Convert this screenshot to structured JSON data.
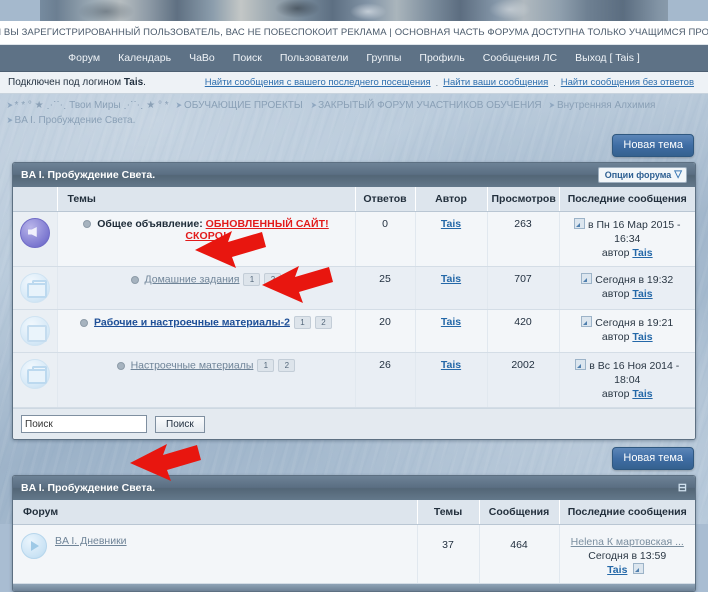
{
  "banner": {
    "notice": "ЕСЛИ ВЫ ЗАРЕГИСТРИРОВАННЫЙ ПОЛЬЗОВАТЕЛЬ, ВАС НЕ ПОБЕСПОКОИТ РЕКЛАМА | ОСНОВНАЯ ЧАСТЬ ФОРУМА ДОСТУПНА ТОЛЬКО УЧАЩИМСЯ ПРОЕКТА"
  },
  "nav": {
    "items": [
      {
        "label": "Форум",
        "name": "nav-forum"
      },
      {
        "label": "Календарь",
        "name": "nav-calendar"
      },
      {
        "label": "ЧаВо",
        "name": "nav-faq"
      },
      {
        "label": "Поиск",
        "name": "nav-search"
      },
      {
        "label": "Пользователи",
        "name": "nav-users"
      },
      {
        "label": "Группы",
        "name": "nav-groups"
      },
      {
        "label": "Профиль",
        "name": "nav-profile"
      },
      {
        "label": "Сообщения ЛС",
        "name": "nav-pm"
      },
      {
        "label": "Выход [ Tais ]",
        "name": "nav-logout"
      }
    ]
  },
  "login_strip": {
    "text_prefix": "Подключен под логином ",
    "username": "Tais",
    "text_suffix": ".",
    "quick_links": [
      "Найти сообщения с вашего последнего посещения",
      "Найти ваши сообщения",
      "Найти сообщения без ответов"
    ],
    "separator": "."
  },
  "breadcrumb": {
    "row1": [
      "* * ° ★ ⋰⋱ Твои Миры ⋰⋱ ★ ° *",
      "ОБУЧАЮЩИЕ ПРОЕКТЫ",
      "ЗАКРЫТЫЙ ФОРУМ УЧАСТНИКОВ ОБУЧЕНИЯ",
      "Внутренняя Алхимия"
    ],
    "row2": [
      "BA I. Пробуждение Света."
    ]
  },
  "buttons": {
    "new_topic_top": "Новая тема",
    "new_topic_bottom": "Новая тема"
  },
  "topics_panel": {
    "title": "BA I. Пробуждение Света.",
    "forum_options": "Опции форума",
    "columns": [
      "",
      "Темы",
      "Ответов",
      "Автор",
      "Просмотров",
      "Последние сообщения"
    ],
    "rows": [
      {
        "icon": "announcement-icon",
        "prefix": "Общее объявление:",
        "title": "ОБНОВЛЕННЫЙ САЙТ! СКОРО!",
        "is_announcement": true,
        "unread": false,
        "pages": [],
        "replies": "0",
        "author": "Tais",
        "views": "263",
        "last_post_date": "в Пн 16 Мар 2015 - 16:34",
        "last_post_author_prefix": "автор",
        "last_post_author": "Tais"
      },
      {
        "icon": "folder-open-icon",
        "prefix": "",
        "title": "Домашние задания",
        "is_announcement": false,
        "unread": false,
        "pages": [
          "1",
          "2"
        ],
        "replies": "25",
        "author": "Tais",
        "views": "707",
        "last_post_date": "Сегодня в 19:32",
        "last_post_author_prefix": "автор",
        "last_post_author": "Tais"
      },
      {
        "icon": "folder-icon",
        "prefix": "",
        "title": "Рабочие и настроечные материалы-2",
        "is_announcement": false,
        "unread": true,
        "pages": [
          "1",
          "2"
        ],
        "replies": "20",
        "author": "Tais",
        "views": "420",
        "last_post_date": "Сегодня в 19:21",
        "last_post_author_prefix": "автор",
        "last_post_author": "Tais"
      },
      {
        "icon": "folder-open-icon",
        "prefix": "",
        "title": "Настроечные материалы",
        "is_announcement": false,
        "unread": false,
        "pages": [
          "1",
          "2"
        ],
        "replies": "26",
        "author": "Tais",
        "views": "2002",
        "last_post_date": "в Вс 16 Ноя 2014 - 18:04",
        "last_post_author_prefix": "автор",
        "last_post_author": "Tais"
      }
    ],
    "search": {
      "value": "Поиск",
      "button": "Поиск"
    }
  },
  "forums_panel": {
    "title": "BA I. Пробуждение Света.",
    "columns": [
      "Форум",
      "Темы",
      "Сообщения",
      "Последние сообщения"
    ],
    "rows": [
      {
        "icon": "forum-arrow-icon",
        "name": "BA I. Дневники",
        "topics": "37",
        "messages": "464",
        "last_title": "Helena К мартовская ...",
        "last_date": "Сегодня в 13:59",
        "last_author": "Tais"
      }
    ]
  },
  "colors": {
    "accent_blue": "#2468a8",
    "announce_red": "#e21b1b",
    "unread_blue": "#1e4f97",
    "nav_bar": "#5e7286",
    "panel_head": "#5a6e82",
    "arrow_red": "#e8160f"
  },
  "annotations": {
    "arrows": [
      {
        "name": "arrow-to-homework-topic"
      },
      {
        "name": "arrow-to-materials-topic"
      },
      {
        "name": "arrow-to-diaries-forum"
      }
    ]
  }
}
